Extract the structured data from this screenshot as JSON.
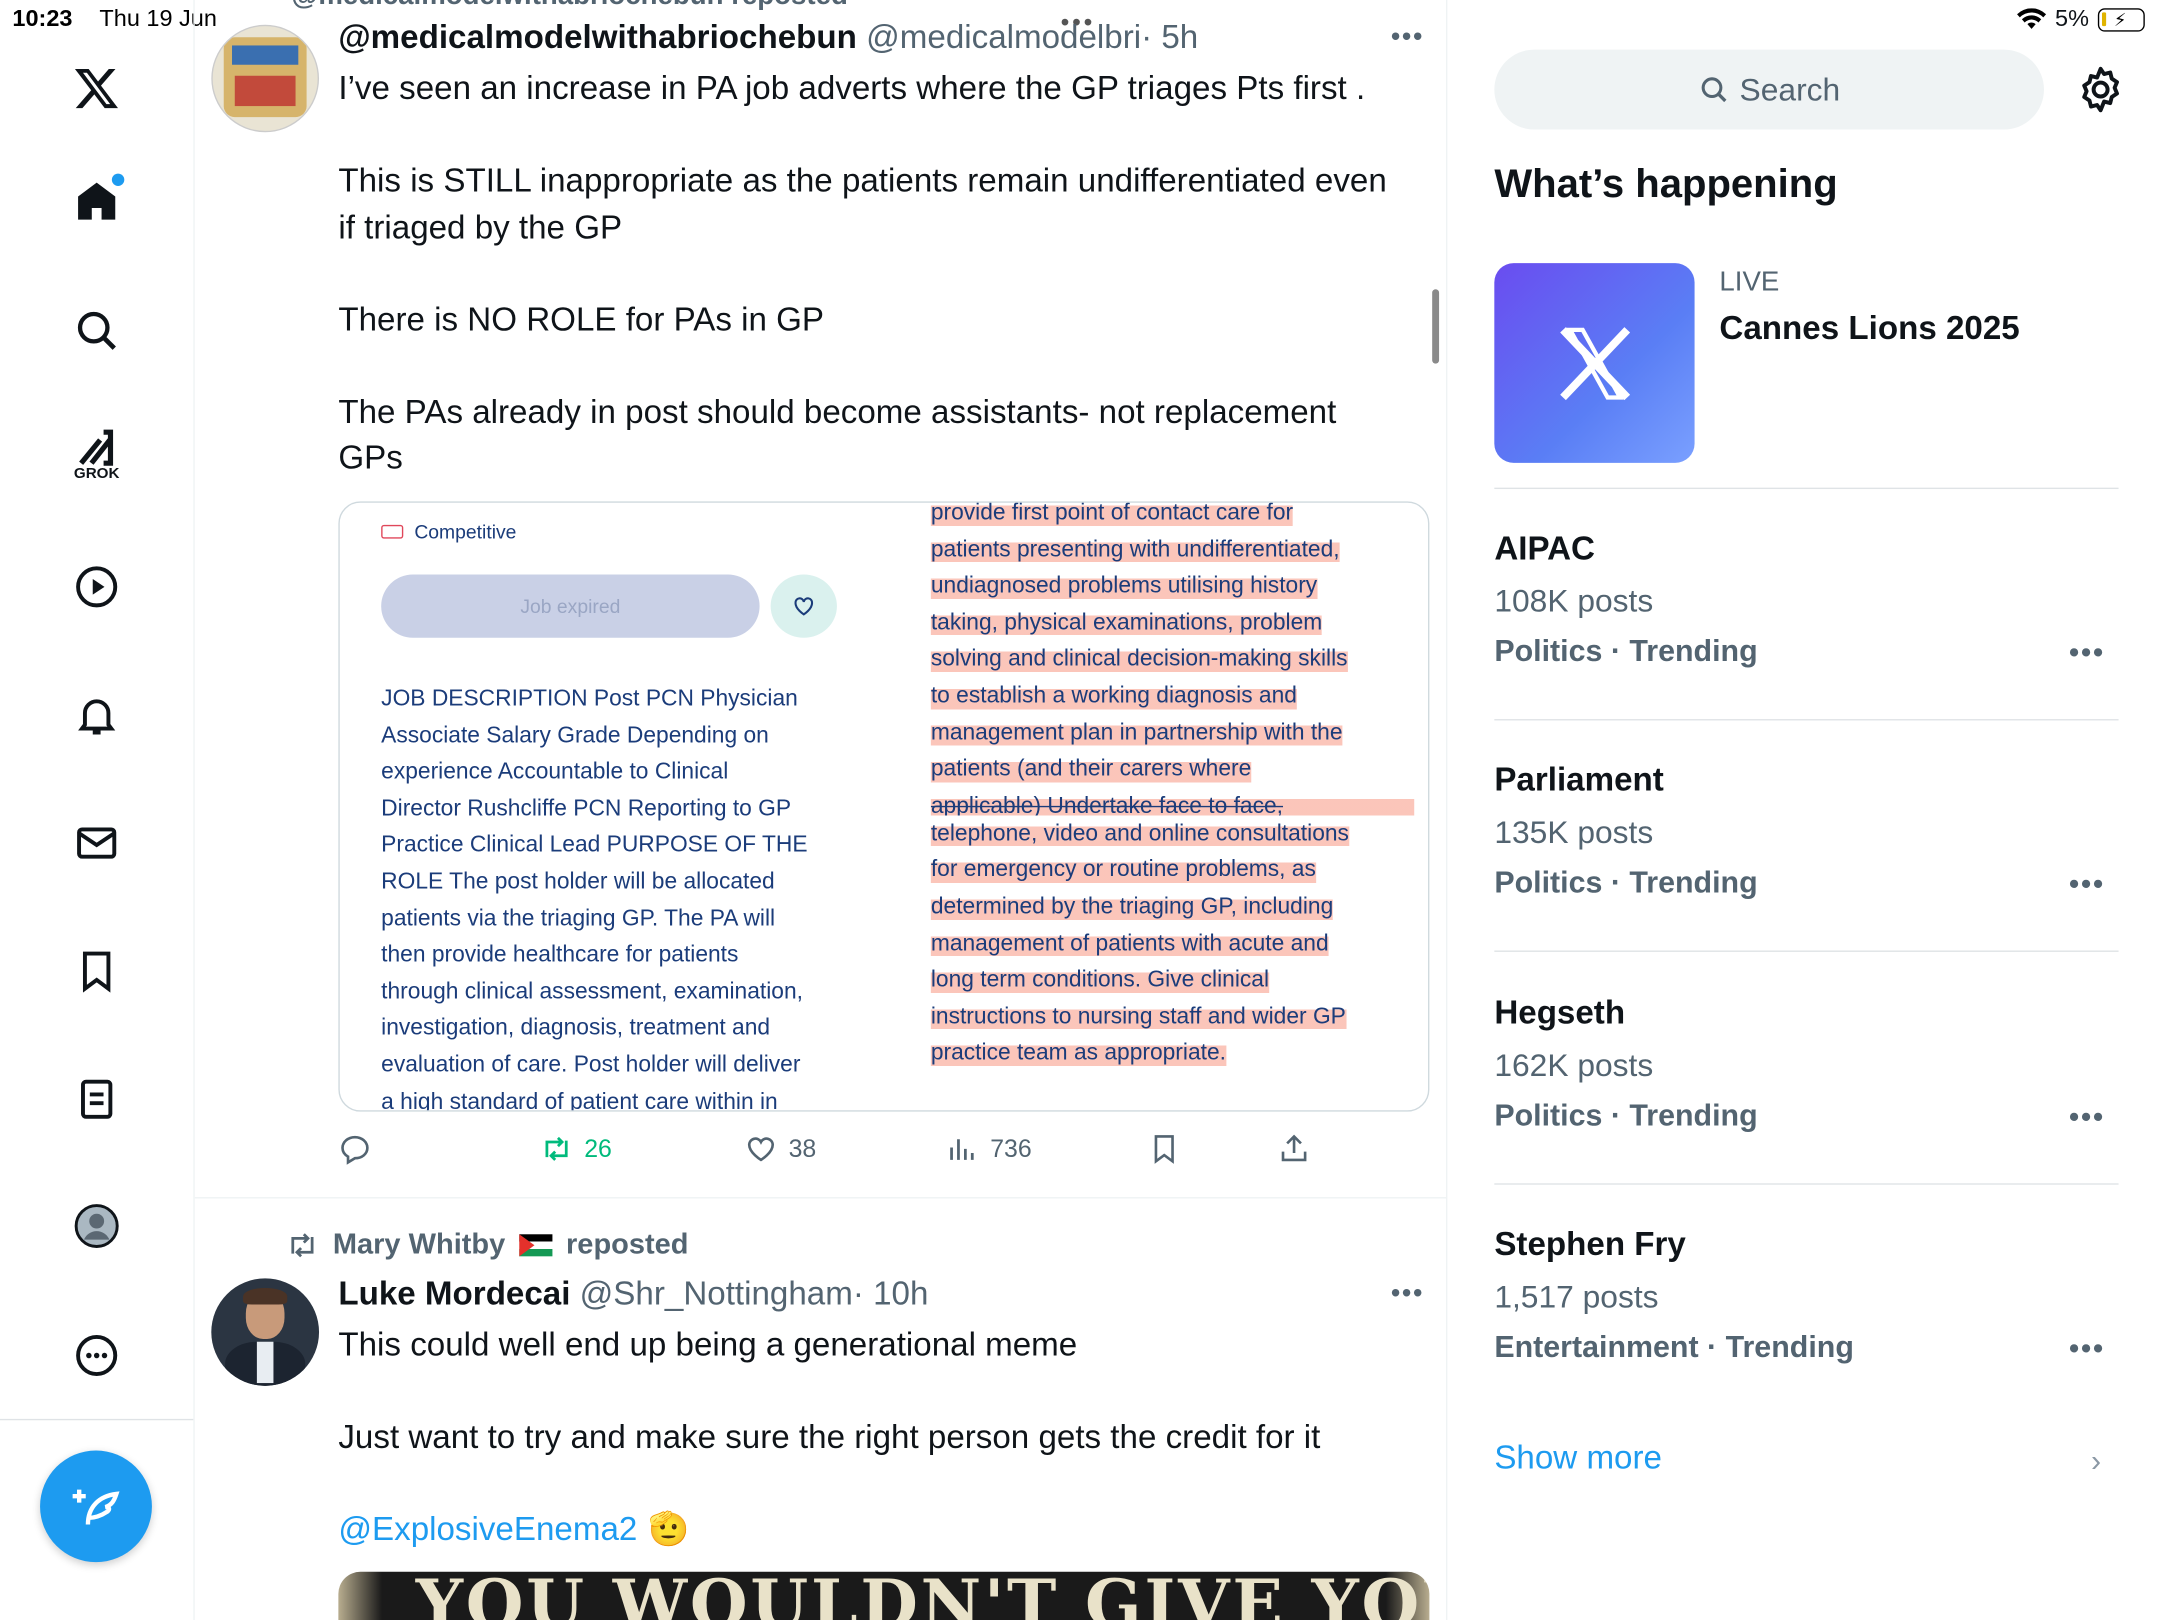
{
  "status_bar": {
    "time": "10:23",
    "date": "Thu 19 Jun",
    "battery": "5%"
  },
  "nav": {
    "grok_label": "GROK"
  },
  "tweet1": {
    "repost_partial": "@medicalmodelwithabriochebun reposted",
    "author": "@medicalmodelwithabriochebun",
    "handle": "@medicalmodelbri",
    "time": "· 5h",
    "text_lines": [
      "I’ve seen an increase in PA job adverts where the GP triages Pts first .",
      "",
      "This is STILL inappropriate as the patients remain undifferentiated even",
      "if triaged by the GP",
      "",
      "There is NO ROLE for PAs in GP",
      "",
      "The PAs already in post should become assistants- not replacement",
      "GPs"
    ],
    "media": {
      "badge": "Competitive",
      "expired_button": "Job expired",
      "left_text": [
        "JOB DESCRIPTION Post PCN Physician",
        "Associate Salary Grade Depending on",
        "experience Accountable to Clinical",
        "Director Rushcliffe PCN Reporting to GP",
        "Practice Clinical Lead PURPOSE OF THE",
        "ROLE The post holder will be allocated",
        "patients via the triaging GP. The PA will",
        "then provide healthcare for patients",
        "through clinical assessment, examination,",
        "investigation, diagnosis, treatment and",
        "evaluation of care. Post holder will deliver",
        "a high standard of patient care within in"
      ],
      "right_text": [
        "provide first point of contact care for",
        "patients presenting with undifferentiated,",
        "undiagnosed problems utilising history",
        "taking, physical examinations, problem",
        "solving and clinical decision-making skills",
        "to establish a working diagnosis and",
        "management plan in partnership with the",
        "patients (and their carers where",
        "applicable) Undertake face to face,",
        "telephone, video and online consultations",
        "for emergency or routine problems, as",
        "determined by the triaging GP, including",
        "management of patients with acute and",
        "long term conditions. Give clinical",
        "instructions to nursing staff and wider GP",
        "practice team as appropriate."
      ]
    },
    "stats": {
      "reposts": "26",
      "likes": "38",
      "views": "736"
    }
  },
  "tweet2": {
    "reposted_by": "Mary Whitby",
    "reposted_suffix": "reposted",
    "author": "Luke Mordecai",
    "handle": "@Shr_Nottingham",
    "time": "· 10h",
    "line1": "This could well end up being a generational meme",
    "line2": "Just want to try and make sure the right person gets the credit for it",
    "mention": "@ExplosiveEnema2",
    "emoji": "🫡",
    "image_text": "YOU WOULDN'T GIVE YOUR"
  },
  "sidebar": {
    "search_placeholder": "Search",
    "heading": "What’s happening",
    "live_label": "LIVE",
    "live_title": "Cannes Lions 2025",
    "trends": [
      {
        "name": "AIPAC",
        "posts": "108K posts",
        "category": "Politics · Trending"
      },
      {
        "name": "Parliament",
        "posts": "135K posts",
        "category": "Politics · Trending"
      },
      {
        "name": "Hegseth",
        "posts": "162K posts",
        "category": "Politics · Trending"
      },
      {
        "name": "Stephen Fry",
        "posts": "1,517 posts",
        "category": "Entertainment · Trending"
      }
    ],
    "show_more": "Show more"
  },
  "colors": {
    "accent": "#1d9bf0",
    "repost_green": "#00ba7c",
    "muted": "#536471"
  }
}
